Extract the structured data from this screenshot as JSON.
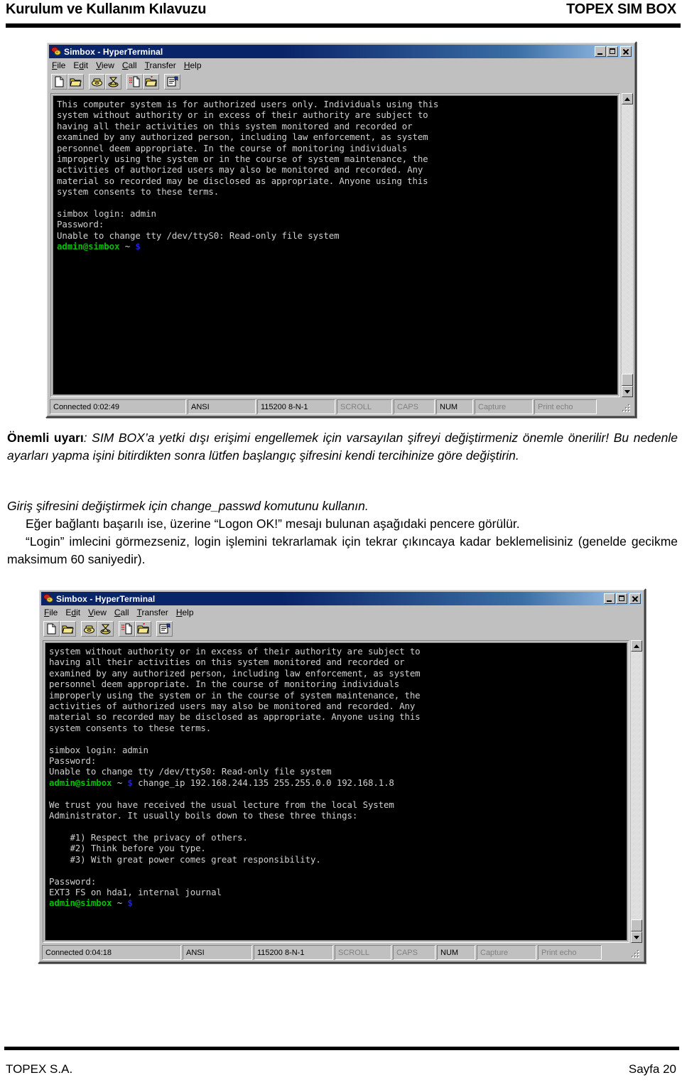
{
  "header": {
    "left_title": "Kurulum ve Kullanım Kılavuzu",
    "right_title": "TOPEX SIM BOX"
  },
  "footer": {
    "left": "TOPEX S.A.",
    "right": "Sayfa 20"
  },
  "window_common": {
    "title": "Simbox - HyperTerminal",
    "menu": [
      {
        "pre": "F",
        "key": "i",
        "post": "le",
        "label": "File"
      },
      {
        "pre": "E",
        "key": "d",
        "post": "it",
        "label": "Edit"
      },
      {
        "pre": "",
        "key": "V",
        "post": "iew",
        "label": "View"
      },
      {
        "pre": "",
        "key": "C",
        "post": "all",
        "label": "Call"
      },
      {
        "pre": "",
        "key": "T",
        "post": "ransfer",
        "label": "Transfer"
      },
      {
        "pre": "",
        "key": "H",
        "post": "elp",
        "label": "Help"
      }
    ],
    "toolbar_buttons": [
      "new-connection-icon",
      "open-folder-icon",
      "call-phone-icon",
      "disconnect-phone-icon",
      "send-file-icon",
      "receive-file-icon",
      "properties-icon"
    ],
    "title_buttons": [
      "minimize-button",
      "maximize-button",
      "close-button"
    ],
    "status_fields": {
      "encoding": "ANSI",
      "line_settings": "115200 8-N-1",
      "scroll": "SCROLL",
      "caps": "CAPS",
      "num": "NUM",
      "capture": "Capture",
      "print_echo": "Print echo"
    }
  },
  "window_1": {
    "status_connected": "Connected 0:02:49",
    "terminal_lines": [
      {
        "segments": [
          {
            "t": "This computer system is for authorized users only. Individuals using this",
            "c": "w"
          }
        ]
      },
      {
        "segments": [
          {
            "t": "system without authority or in excess of their authority are subject to",
            "c": "w"
          }
        ]
      },
      {
        "segments": [
          {
            "t": "having all their activities on this system monitored and recorded or",
            "c": "w"
          }
        ]
      },
      {
        "segments": [
          {
            "t": "examined by any authorized person, including law enforcement, as system",
            "c": "w"
          }
        ]
      },
      {
        "segments": [
          {
            "t": "personnel deem appropriate. In the course of monitoring individuals",
            "c": "w"
          }
        ]
      },
      {
        "segments": [
          {
            "t": "improperly using the system or in the course of system maintenance, the",
            "c": "w"
          }
        ]
      },
      {
        "segments": [
          {
            "t": "activities of authorized users may also be monitored and recorded. Any",
            "c": "w"
          }
        ]
      },
      {
        "segments": [
          {
            "t": "material so recorded may be disclosed as appropriate. Anyone using this",
            "c": "w"
          }
        ]
      },
      {
        "segments": [
          {
            "t": "system consents to these terms.",
            "c": "w"
          }
        ]
      },
      {
        "segments": [
          {
            "t": "",
            "c": "w"
          }
        ]
      },
      {
        "segments": [
          {
            "t": "simbox login: admin",
            "c": "w"
          }
        ]
      },
      {
        "segments": [
          {
            "t": "Password:",
            "c": "w"
          }
        ]
      },
      {
        "segments": [
          {
            "t": "Unable to change tty /dev/ttyS0: Read-only file system",
            "c": "w"
          }
        ]
      },
      {
        "segments": [
          {
            "t": "admin@simbox",
            "c": "g"
          },
          {
            "t": " ~ ",
            "c": "w"
          },
          {
            "t": "$",
            "c": "b"
          }
        ]
      }
    ]
  },
  "window_2": {
    "status_connected": "Connected 0:04:18",
    "terminal_lines": [
      {
        "segments": [
          {
            "t": "system without authority or in excess of their authority are subject to",
            "c": "w"
          }
        ]
      },
      {
        "segments": [
          {
            "t": "having all their activities on this system monitored and recorded or",
            "c": "w"
          }
        ]
      },
      {
        "segments": [
          {
            "t": "examined by any authorized person, including law enforcement, as system",
            "c": "w"
          }
        ]
      },
      {
        "segments": [
          {
            "t": "personnel deem appropriate. In the course of monitoring individuals",
            "c": "w"
          }
        ]
      },
      {
        "segments": [
          {
            "t": "improperly using the system or in the course of system maintenance, the",
            "c": "w"
          }
        ]
      },
      {
        "segments": [
          {
            "t": "activities of authorized users may also be monitored and recorded. Any",
            "c": "w"
          }
        ]
      },
      {
        "segments": [
          {
            "t": "material so recorded may be disclosed as appropriate. Anyone using this",
            "c": "w"
          }
        ]
      },
      {
        "segments": [
          {
            "t": "system consents to these terms.",
            "c": "w"
          }
        ]
      },
      {
        "segments": [
          {
            "t": "",
            "c": "w"
          }
        ]
      },
      {
        "segments": [
          {
            "t": "simbox login: admin",
            "c": "w"
          }
        ]
      },
      {
        "segments": [
          {
            "t": "Password:",
            "c": "w"
          }
        ]
      },
      {
        "segments": [
          {
            "t": "Unable to change tty /dev/ttyS0: Read-only file system",
            "c": "w"
          }
        ]
      },
      {
        "segments": [
          {
            "t": "admin@simbox",
            "c": "g"
          },
          {
            "t": " ~ ",
            "c": "w"
          },
          {
            "t": "$",
            "c": "b"
          },
          {
            "t": " change_ip 192.168.244.135 255.255.0.0 192.168.1.8",
            "c": "w"
          }
        ]
      },
      {
        "segments": [
          {
            "t": "",
            "c": "w"
          }
        ]
      },
      {
        "segments": [
          {
            "t": "We trust you have received the usual lecture from the local System",
            "c": "w"
          }
        ]
      },
      {
        "segments": [
          {
            "t": "Administrator. It usually boils down to these three things:",
            "c": "w"
          }
        ]
      },
      {
        "segments": [
          {
            "t": "",
            "c": "w"
          }
        ]
      },
      {
        "segments": [
          {
            "t": "    #1) Respect the privacy of others.",
            "c": "w"
          }
        ]
      },
      {
        "segments": [
          {
            "t": "    #2) Think before you type.",
            "c": "w"
          }
        ]
      },
      {
        "segments": [
          {
            "t": "    #3) With great power comes great responsibility.",
            "c": "w"
          }
        ]
      },
      {
        "segments": [
          {
            "t": "",
            "c": "w"
          }
        ]
      },
      {
        "segments": [
          {
            "t": "Password:",
            "c": "w"
          }
        ]
      },
      {
        "segments": [
          {
            "t": "EXT3 FS on hda1, internal journal",
            "c": "w"
          }
        ]
      },
      {
        "segments": [
          {
            "t": "admin@simbox",
            "c": "g"
          },
          {
            "t": " ~ ",
            "c": "w"
          },
          {
            "t": "$",
            "c": "b"
          }
        ]
      }
    ]
  },
  "body": {
    "warning_bold": "Önemli uyarı",
    "warning_rest": ": SIM BOX’a yetki dışı erişimi engellemek için varsayılan şifreyi değiştirmeniz önemle önerilir! Bu nedenle ayarları yapma işini bitirdikten sonra lütfen başlangıç şifresini kendi tercihinize göre değiştirin.",
    "para_change_passwd": "Giriş şifresini değiştirmek için change_passwd komutunu kullanın.",
    "para_logon_ok": "Eğer bağlantı başarılı ise, üzerine “Logon OK!” mesajı bulunan aşağıdaki pencere görülür.",
    "para_login_wait": "“Login” imlecini görmezseniz, login işlemini tekrarlamak için tekrar çıkıncaya kadar beklemelisiniz (genelde gecikme maksimum 60 saniyedir)."
  },
  "colors": {
    "titlebar_start": "#0a246a",
    "titlebar_end": "#a6caf0",
    "window_face": "#c0c0c0",
    "terminal_bg": "#000000",
    "terminal_fg": "#c8c8c8",
    "prompt_user": "#00c000",
    "prompt_dollar": "#2020e0"
  }
}
